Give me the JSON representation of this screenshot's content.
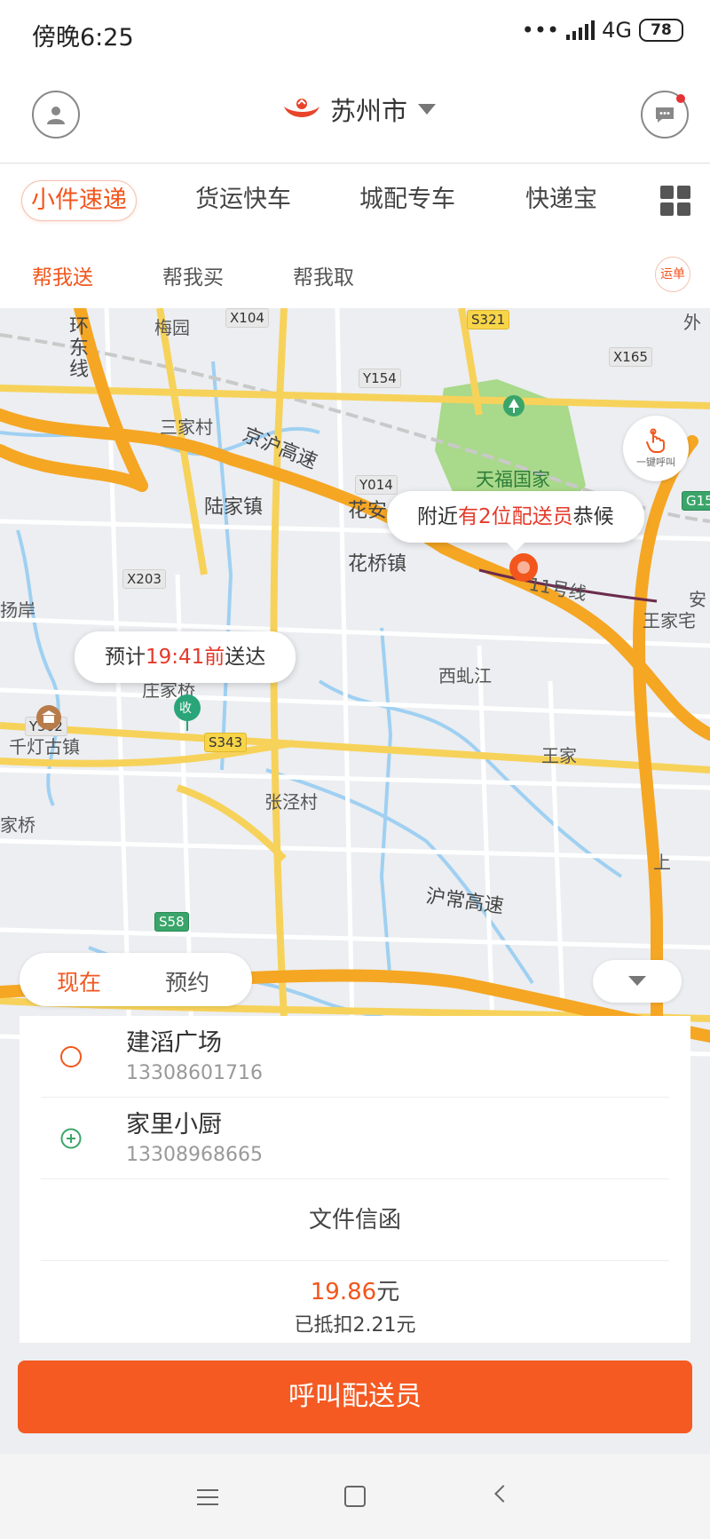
{
  "status_bar": {
    "time": "傍晚6:25",
    "signal_dots": "•••",
    "network": "4G",
    "battery": "78"
  },
  "header": {
    "city": "苏州市"
  },
  "services": [
    "小件速递",
    "货运快车",
    "城配专车",
    "快递宝"
  ],
  "sub_tabs": [
    "帮我送",
    "帮我买",
    "帮我取"
  ],
  "orders_label": "运单",
  "map": {
    "nearby_prefix": "附近",
    "nearby_highlight": "有2位配送员",
    "nearby_suffix": "恭候",
    "eta_prefix": "预计",
    "eta_time": "19:41前",
    "eta_suffix": "送达",
    "one_key_call": "一键呼叫",
    "labels": {
      "huandongxian": "环东线",
      "meiyuan": "梅园",
      "sanjiacun": "三家村",
      "lujiazhen": "陆家镇",
      "huaqiaozhen": "花桥镇",
      "huaan": "花安",
      "jinghu": "京沪高速",
      "park": "天福国家湿地公园",
      "xihongjiang": "西虬江",
      "qiandeng": "千灯古镇",
      "zhangjingcun": "张泾村",
      "wangjia": "王家",
      "wangjiazhai": "王家宅",
      "huchang": "沪常高速",
      "line11": "11号线",
      "zhuangjiaqiao": "庄家桥",
      "yang": "扬岸",
      "jiajiaqiao": "家桥",
      "wai": "外",
      "zhai": "宅",
      "an": "安",
      "shang": "上",
      "receive": "收"
    },
    "road_codes": {
      "x104": "X104",
      "s321": "S321",
      "y154": "Y154",
      "x165": "X165",
      "y014": "Y014",
      "g15": "G15",
      "x203": "X203",
      "y502": "Y502",
      "s343": "S343",
      "s58": "S58"
    }
  },
  "mode": {
    "now": "现在",
    "reserve": "预约"
  },
  "order": {
    "from_name": "建滔广场",
    "from_phone": "13308601716",
    "to_name": "家里小厨",
    "to_phone": "13308968665",
    "item_type": "文件信函",
    "price_amount": "19.86",
    "price_unit": "元",
    "discount": "已抵扣2.21元"
  },
  "cta_label": "呼叫配送员",
  "colors": {
    "accent": "#f2561d",
    "cta": "#f45a22",
    "highlight": "#e53a2a",
    "park": "#a9d98a"
  }
}
